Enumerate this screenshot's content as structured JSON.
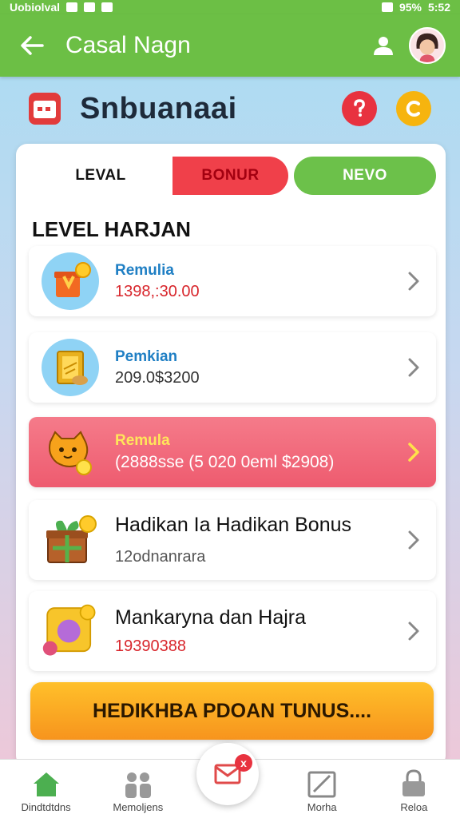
{
  "status_bar": {
    "left_text": "Uobiolval",
    "battery": "95%",
    "time": "5:52"
  },
  "app_bar": {
    "title": "Casal Nagn"
  },
  "header": {
    "title": "Snbuanaai"
  },
  "tabs": [
    {
      "label": "LEVAL"
    },
    {
      "label": "BONUR"
    },
    {
      "label": "NEVO"
    }
  ],
  "section_title": "LEVEL HARJAN",
  "items": [
    {
      "title": "Remulia",
      "subtitle": "1398,:30.00",
      "icon": "gift-box-coin-icon"
    },
    {
      "title": "Pemkian",
      "subtitle": "209.0$3200",
      "icon": "gold-bar-icon"
    },
    {
      "title": "Remula",
      "subtitle": "(2888sse (5 020 0eml $2908)",
      "icon": "cat-coin-icon"
    },
    {
      "title": "Hadikan Ia Hadikan Bonus",
      "subtitle": "12odnanrara",
      "icon": "present-coin-icon"
    },
    {
      "title": "Mankaryna dan Hajra",
      "subtitle": "19390388",
      "icon": "purse-coin-icon"
    }
  ],
  "promo_button": "HEDIKHBA PDOAN TUNUS....",
  "bottom_nav": [
    {
      "label": "Dindtdtdns",
      "icon": "home-icon"
    },
    {
      "label": "Memoljens",
      "icon": "people-icon"
    },
    {
      "label": "",
      "icon": "mail-icon",
      "badge": "x"
    },
    {
      "label": "Morha",
      "icon": "edit-icon"
    },
    {
      "label": "Reloa",
      "icon": "lock-icon"
    }
  ],
  "colors": {
    "brand_green": "#6cbf45",
    "accent_red": "#e8323f",
    "accent_orange": "#f7941d"
  }
}
